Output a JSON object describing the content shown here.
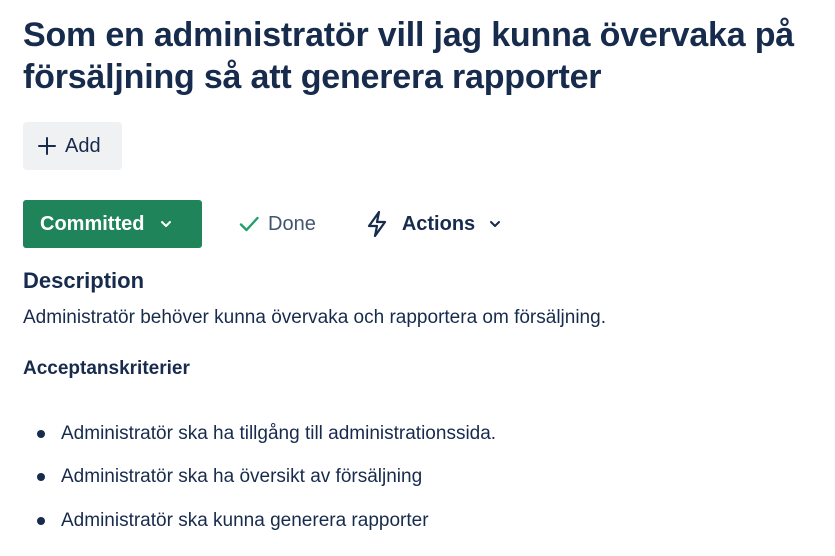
{
  "issue": {
    "title": "Som en administratör vill jag kunna övervaka på försäljning så att generera rapporter"
  },
  "toolbar": {
    "add_label": "Add"
  },
  "status": {
    "current": "Committed",
    "color": "#1f845a",
    "done_label": "Done",
    "actions_label": "Actions"
  },
  "description": {
    "heading": "Description",
    "text": "Administratör behöver kunna övervaka och rapportera om försäljning.",
    "criteria_heading": "Acceptanskriterier",
    "criteria": [
      "Administratör ska ha tillgång till administrationssida.",
      "Administratör ska ha översikt av försäljning",
      "Administratör ska kunna generera rapporter"
    ]
  },
  "icons": {
    "add": "plus-icon",
    "status_dropdown": "chevron-down-icon",
    "done": "check-icon",
    "actions": "lightning-bolt-icon",
    "actions_dropdown": "chevron-down-icon"
  }
}
